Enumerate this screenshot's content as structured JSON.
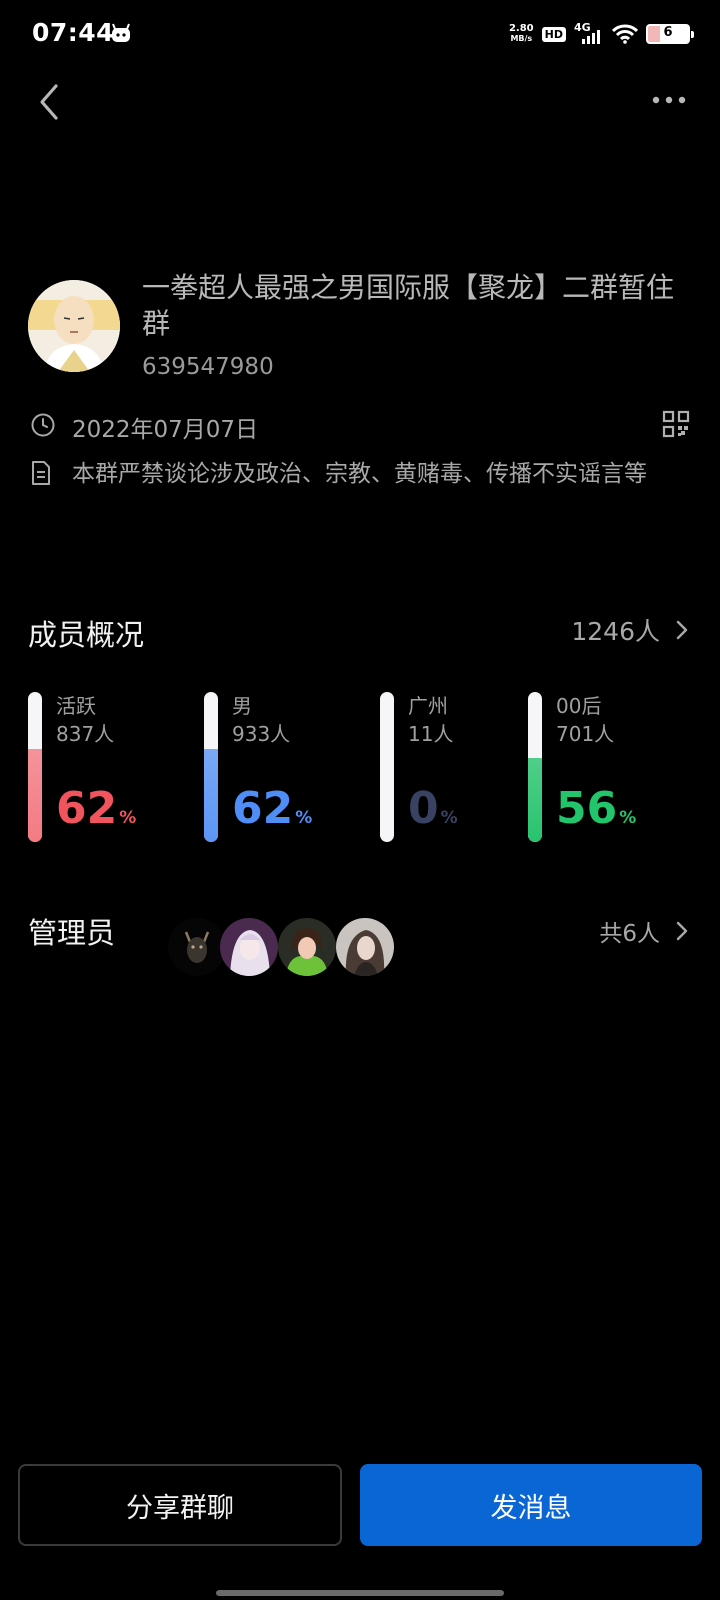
{
  "status_bar": {
    "time": "07:44",
    "speed_value": "2.80",
    "speed_unit": "MB/s",
    "hd": "HD",
    "network": "4G",
    "battery": "6"
  },
  "nav": {
    "back_icon": "chevron-left-icon",
    "more_icon": "more-horizontal-icon"
  },
  "group": {
    "name": "一拳超人最强之男国际服【聚龙】二群暂住群",
    "id": "639547980",
    "created": "2022年07月07日",
    "notice": "本群严禁谈论涉及政治、宗教、黄赌毒、传播不实谣言等"
  },
  "members": {
    "title": "成员概况",
    "total": "1246人",
    "stats": [
      {
        "label": "活跃",
        "count": "837人",
        "percent": "62",
        "unit": "%",
        "fill": 0.62,
        "color": "#f2545e",
        "fill_color": "#f47a83"
      },
      {
        "label": "男",
        "count": "933人",
        "percent": "62",
        "unit": "%",
        "fill": 0.62,
        "color": "#4f8ef7",
        "fill_color": "#5b95f5"
      },
      {
        "label": "广州",
        "count": "11人",
        "percent": "0",
        "unit": "%",
        "fill": 0.0,
        "color": "#3a4263",
        "fill_color": "#3a4263"
      },
      {
        "label": "00后",
        "count": "701人",
        "percent": "56",
        "unit": "%",
        "fill": 0.56,
        "color": "#22c56b",
        "fill_color": "#27c46e"
      }
    ]
  },
  "admins": {
    "title": "管理员",
    "count": "共6人"
  },
  "actions": {
    "share": "分享群聊",
    "send": "发消息"
  }
}
